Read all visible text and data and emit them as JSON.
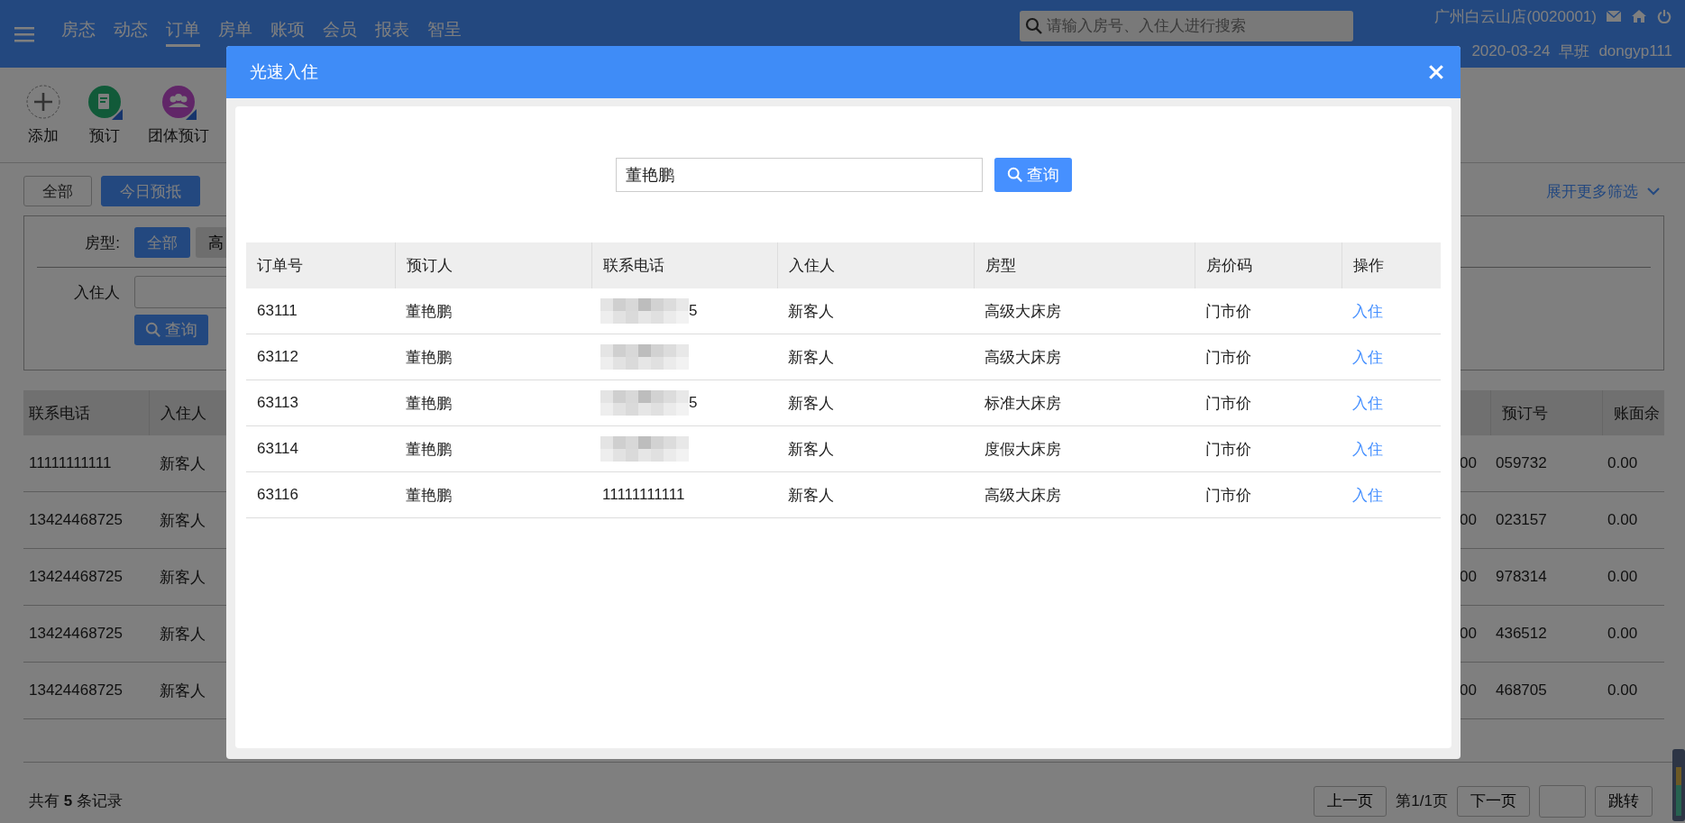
{
  "header": {
    "nav": [
      {
        "label": "房态",
        "selected": false
      },
      {
        "label": "动态",
        "selected": false
      },
      {
        "label": "订单",
        "selected": true
      },
      {
        "label": "房单",
        "selected": false
      },
      {
        "label": "账项",
        "selected": false
      },
      {
        "label": "会员",
        "selected": false
      },
      {
        "label": "报表",
        "selected": false
      },
      {
        "label": "智呈",
        "selected": false
      }
    ],
    "search": {
      "placeholder": "请输入房号、入住人进行搜索"
    },
    "store": "广州白云山店(0020001)",
    "date": "2020-03-24",
    "shift": "早班",
    "user": "dongyp111"
  },
  "toolbar": [
    {
      "kind": "add",
      "label": "添加"
    },
    {
      "kind": "booking",
      "label": "预订"
    },
    {
      "kind": "group",
      "label": "团体预订"
    }
  ],
  "filters": [
    {
      "label": "全部",
      "selected": false
    },
    {
      "label": "今日预抵",
      "selected": true
    }
  ],
  "more_filters": "展开更多筛选",
  "filter_panel": {
    "room_type_label": "房型:",
    "room_types": [
      {
        "label": "全部",
        "selected": true
      },
      {
        "label": "高",
        "selected": false
      }
    ],
    "guest_label": "入住人",
    "search_button": "查询"
  },
  "orders_table": {
    "columns_left": [
      "联系电话",
      "入住人"
    ],
    "columns_right": [
      "预订号",
      "账面余"
    ],
    "rows": [
      {
        "phone": "11111111111",
        "guest": "新客人",
        "amount": "00",
        "booking_no": "059732",
        "balance": "0.00"
      },
      {
        "phone": "13424468725",
        "guest": "新客人",
        "amount": "00",
        "booking_no": "023157",
        "balance": "0.00"
      },
      {
        "phone": "13424468725",
        "guest": "新客人",
        "amount": "00",
        "booking_no": "978314",
        "balance": "0.00"
      },
      {
        "phone": "13424468725",
        "guest": "新客人",
        "amount": "00",
        "booking_no": "436512",
        "balance": "0.00"
      },
      {
        "phone": "13424468725",
        "guest": "新客人",
        "amount": "00",
        "booking_no": "468705",
        "balance": "0.00"
      }
    ]
  },
  "footer": {
    "total": "共有 **5** 条记录",
    "prev": "上一页",
    "page": "第1/1页",
    "next": "下一页",
    "jump": "跳转"
  },
  "dialog": {
    "title": "光速入住",
    "search_value": "董艳鹏",
    "search_button": "查询",
    "columns": [
      "订单号",
      "预订人",
      "联系电话",
      "入住人",
      "房型",
      "房价码",
      "操作"
    ],
    "rows": [
      {
        "order_no": "63111",
        "booker": "董艳鹏",
        "phone_masked": true,
        "phone": "5",
        "guest": "新客人",
        "room_type": "高级大床房",
        "rate_code": "门市价",
        "action": "入住"
      },
      {
        "order_no": "63112",
        "booker": "董艳鹏",
        "phone_masked": true,
        "guest": "新客人",
        "room_type": "高级大床房",
        "rate_code": "门市价",
        "action": "入住"
      },
      {
        "order_no": "63113",
        "booker": "董艳鹏",
        "phone_masked": true,
        "phone": "5",
        "guest": "新客人",
        "room_type": "标准大床房",
        "rate_code": "门市价",
        "action": "入住"
      },
      {
        "order_no": "63114",
        "booker": "董艳鹏",
        "phone_masked": true,
        "guest": "新客人",
        "room_type": "度假大床房",
        "rate_code": "门市价",
        "action": "入住"
      },
      {
        "order_no": "63116",
        "booker": "董艳鹏",
        "phone_masked": false,
        "phone": "11111111111",
        "guest": "新客人",
        "room_type": "高级大床房",
        "rate_code": "门市价",
        "action": "入住"
      }
    ]
  }
}
